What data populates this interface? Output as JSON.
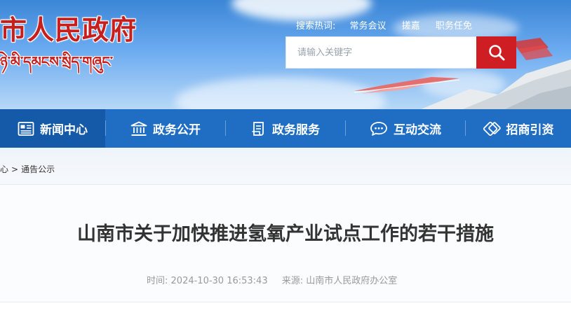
{
  "header": {
    "title_cn": "市人民政府",
    "title_tibetan": "ཉེ་མི་དམངས་སྲིད་གཞུང་",
    "hot_search": {
      "label": "搜索热词:",
      "items": [
        "常务会议",
        "搓嘉",
        "职务任免"
      ]
    },
    "search": {
      "placeholder": "请输入关键字",
      "button_icon": "search-icon"
    }
  },
  "nav": {
    "items": [
      {
        "label": "新闻中心",
        "icon": "news-icon",
        "active": true
      },
      {
        "label": "政务公开",
        "icon": "government-building-icon",
        "active": false
      },
      {
        "label": "政务服务",
        "icon": "service-document-icon",
        "active": false
      },
      {
        "label": "互动交流",
        "icon": "chat-bubble-icon",
        "active": false
      },
      {
        "label": "招商引资",
        "icon": "handshake-icon",
        "active": false
      }
    ]
  },
  "breadcrumb": {
    "parent": "心",
    "separator": ">",
    "current": "通告公示"
  },
  "article": {
    "title": "山南市关于加快推进氢氧产业试点工作的若干措施",
    "time_label": "时间:",
    "time_value": "2024-10-30 16:53:43",
    "source_label": "来源:",
    "source_value": "山南市人民政府办公室"
  },
  "colors": {
    "brand_red": "#c71e1e",
    "nav_blue": "#1f6ec4",
    "nav_active": "#155aa8",
    "search_button": "#cf1d24"
  }
}
